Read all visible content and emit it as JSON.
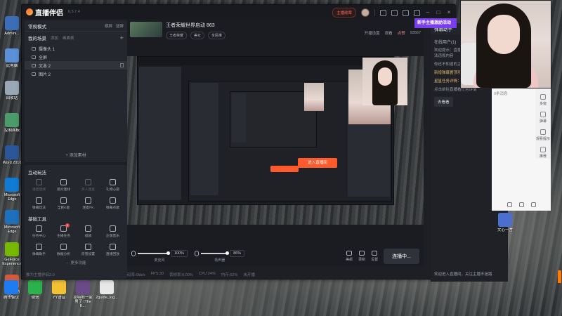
{
  "desktop": {
    "left_icons": [
      {
        "label": "Admini...",
        "color": "#3b6db8"
      },
      {
        "label": "此电脑",
        "color": "#5b8fd8"
      },
      {
        "label": "回收站",
        "color": "#9aa7b5"
      },
      {
        "label": "控制面板",
        "color": "#4a9c6a"
      },
      {
        "label": "Word 2016",
        "color": "#2b579a"
      },
      {
        "label": "Microsoft Edge",
        "color": "#0f7bd4"
      },
      {
        "label": "Microsoft Edge",
        "color": "#1e6fbd"
      },
      {
        "label": "GeForce Experience",
        "color": "#76b900"
      },
      {
        "label": "万象驱动Vic...",
        "color": "#d45a3a"
      }
    ],
    "taskbar_icons": [
      {
        "label": "腾讯会议",
        "color": "#1e7bf0"
      },
      {
        "label": "微信",
        "color": "#2bb24c"
      },
      {
        "label": "YY语音",
        "color": "#f2c232"
      },
      {
        "label": "靠特地一家男了 (The K...",
        "color": "#6b4a8a"
      },
      {
        "label": "2guide_log...",
        "color": "#e8e8e8"
      }
    ],
    "right_icon": {
      "label": "文心一言"
    }
  },
  "app": {
    "logo": "直播伴侣",
    "version": "6.5.7.4",
    "fans_button": "主播勋章",
    "left": {
      "mode": "常规模式",
      "mode_opts": [
        "横屏",
        "竖屏"
      ],
      "scene_tabs": [
        "我的场景",
        "添加",
        "画面表"
      ],
      "sources": [
        {
          "name": "摄像头 1",
          "selected": false
        },
        {
          "name": "全屏",
          "selected": false
        },
        {
          "name": "文本 2",
          "selected": true
        },
        {
          "name": "图片 2",
          "selected": false
        }
      ],
      "add_source": "+ 添加素材",
      "interact_title": "互动玩法",
      "interact_tools": [
        {
          "label": "语音连线",
          "dim": true
        },
        {
          "label": "观众连线",
          "dim": false
        },
        {
          "label": "多人连麦",
          "dim": true
        },
        {
          "label": "礼物心愿",
          "dim": false
        },
        {
          "label": "弹幕玩法",
          "dim": false
        },
        {
          "label": "全民K歌",
          "dim": false
        },
        {
          "label": "连麦PK",
          "dim": false
        },
        {
          "label": "弹幕点歌",
          "dim": false
        }
      ],
      "basic_title": "基础工具",
      "basic_tools": [
        {
          "label": "任务中心",
          "badge": ""
        },
        {
          "label": "主播任务",
          "badge": "1"
        },
        {
          "label": "福袋",
          "badge": ""
        },
        {
          "label": "正版音乐",
          "badge": ""
        },
        {
          "label": "弹幕助手",
          "badge": ""
        },
        {
          "label": "数据分析",
          "badge": ""
        },
        {
          "label": "房管设置",
          "badge": ""
        },
        {
          "label": "直播回放",
          "badge": ""
        }
      ],
      "more": "更多功能",
      "cast_hint": "推为主播伴侣2.0"
    },
    "room": {
      "title": "王者荣耀世界启动 863",
      "category": "王者荣耀",
      "tag": "美女",
      "actions": [
        "开播设置",
        "观看",
        "点赞",
        "93567"
      ],
      "extra_chip": "全民推"
    },
    "preview": {
      "overlay_text": "进入直播间"
    },
    "controls": {
      "mic_label": "麦克风",
      "mic_value": "100%",
      "speaker_label": "扬声器",
      "speaker_value": "86%",
      "right_buttons": [
        "美颜",
        "录制",
        "设置"
      ],
      "live_button": "连播中..."
    },
    "status": [
      "码率:0kb/s",
      "FPS:30",
      "丢帧率:0.00%",
      "CPU:24%",
      "内存:52%",
      "未开播"
    ]
  },
  "side_panel": {
    "title": "弹幕助手",
    "promo": "新手主播激励活动",
    "tabs": [
      "在线用户(1)",
      "观众"
    ],
    "lines": [
      {
        "text": "欢迎提示：直播间文明互动，请勿发布违法违规内容",
        "hl": false
      },
      {
        "text": "你还不知道的主播特权",
        "hl": false
      },
      {
        "text": "新增弹幕置顶功能，点击弹幕添加",
        "hl": true
      },
      {
        "text": "星星任务详情：完成任务可领取积分奖励",
        "hl": true
      },
      {
        "text": "点击前往直播看任务详情",
        "hl": false
      }
    ],
    "link": "去看看",
    "footer": "欢迎进入直播间，关注主播不迷路"
  },
  "far_right": {
    "nav": [
      "多窗",
      "弹幕",
      "观看提示",
      "推荐"
    ],
    "badge": "0条消息"
  },
  "colors": {
    "app_bg": "#1d1f25",
    "accent": "#ff5a2b",
    "promo": "#7a3df0",
    "link": "#4e9bff"
  }
}
